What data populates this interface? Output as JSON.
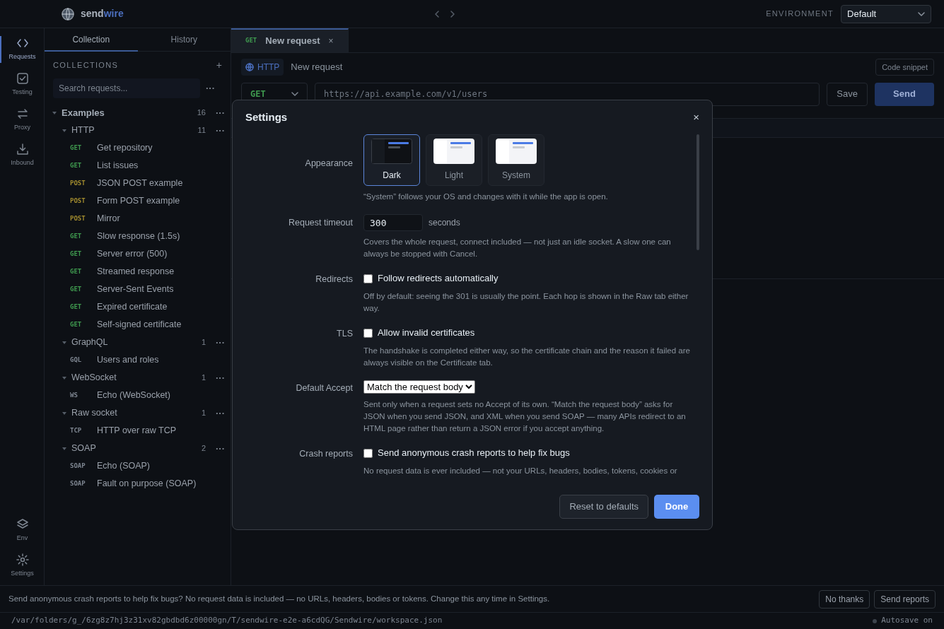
{
  "brand": {
    "first": "send",
    "second": "wire"
  },
  "environment": {
    "label": "ENVIRONMENT",
    "value": "Default"
  },
  "rail": {
    "items": [
      {
        "label": "Requests",
        "selected": true
      },
      {
        "label": "Testing",
        "selected": false
      },
      {
        "label": "Proxy",
        "selected": false
      },
      {
        "label": "Inbound",
        "selected": false
      }
    ],
    "bottom_items": [
      {
        "label": "Env",
        "selected": false
      },
      {
        "label": "Settings",
        "selected": false
      }
    ]
  },
  "panel_tabs": [
    {
      "label": "Collection",
      "selected": true
    },
    {
      "label": "History",
      "selected": false
    }
  ],
  "collections": {
    "heading": "COLLECTIONS",
    "add": "+",
    "search_placeholder": "Search requests...",
    "more": "···"
  },
  "tree": [
    {
      "name": "Examples",
      "count": "16",
      "more": "···",
      "expanded": true,
      "children": [
        {
          "name": "HTTP",
          "count": "11",
          "more": "···",
          "expanded": true,
          "children": [
            {
              "method": "GET",
              "color": "#3f9a4f",
              "name": "Get repository"
            },
            {
              "method": "GET",
              "color": "#3f9a4f",
              "name": "List issues"
            },
            {
              "method": "POST",
              "color": "#a08a2e",
              "name": "JSON POST example"
            },
            {
              "method": "POST",
              "color": "#a08a2e",
              "name": "Form POST example"
            },
            {
              "method": "POST",
              "color": "#a08a2e",
              "name": "Mirror"
            },
            {
              "method": "GET",
              "color": "#3f9a4f",
              "name": "Slow response (1.5s)"
            },
            {
              "method": "GET",
              "color": "#3f9a4f",
              "name": "Server error (500)"
            },
            {
              "method": "GET",
              "color": "#3f9a4f",
              "name": "Streamed response"
            },
            {
              "method": "GET",
              "color": "#3f9a4f",
              "name": "Server-Sent Events"
            },
            {
              "method": "GET",
              "color": "#3f9a4f",
              "name": "Expired certificate"
            },
            {
              "method": "GET",
              "color": "#3f9a4f",
              "name": "Self-signed certificate"
            }
          ]
        },
        {
          "name": "GraphQL",
          "count": "1",
          "more": "···",
          "expanded": true,
          "children": [
            {
              "method": "GQL",
              "color": "#7d8590",
              "name": "Users and roles"
            }
          ]
        },
        {
          "name": "WebSocket",
          "count": "1",
          "more": "···",
          "expanded": true,
          "children": [
            {
              "method": "WS",
              "color": "#7d8590",
              "name": "Echo (WebSocket)"
            }
          ]
        },
        {
          "name": "Raw socket",
          "count": "1",
          "more": "···",
          "expanded": true,
          "children": [
            {
              "method": "TCP",
              "color": "#7d8590",
              "name": "HTTP over raw TCP"
            }
          ]
        },
        {
          "name": "SOAP",
          "count": "2",
          "more": "···",
          "expanded": true,
          "children": [
            {
              "method": "SOAP",
              "color": "#7d8590",
              "name": "Echo (SOAP)"
            },
            {
              "method": "SOAP",
              "color": "#7d8590",
              "name": "Fault on purpose (SOAP)"
            }
          ]
        }
      ]
    }
  ],
  "request_tabs": [
    {
      "method": "GET",
      "title": "New request",
      "close": "×",
      "selected": true
    }
  ],
  "request": {
    "protocol": "HTTP",
    "name": "New request",
    "code_snippet": "Code snippet",
    "method": "GET",
    "url_placeholder": "https://api.example.com/v1/users",
    "save": "Save",
    "send": "Send"
  },
  "settings": {
    "title": "Settings",
    "close": "×",
    "rows": [
      {
        "kind": "theme",
        "label": "Appearance",
        "options": [
          {
            "label": "Dark",
            "kind": "dark",
            "selected": true
          },
          {
            "label": "Light",
            "kind": "light",
            "selected": false
          },
          {
            "label": "System",
            "kind": "system",
            "selected": false
          }
        ],
        "description": "“System” follows your OS and changes with it while the app is open."
      },
      {
        "kind": "number",
        "label": "Request timeout",
        "value": "300",
        "unit": "seconds",
        "description": "Covers the whole request, connect included — not just an idle socket. A slow one can always be stopped with Cancel."
      },
      {
        "kind": "checkbox",
        "label": "Redirects",
        "text": "Follow redirects automatically",
        "checked": false,
        "description": "Off by default: seeing the 301 is usually the point. Each hop is shown in the Raw tab either way."
      },
      {
        "kind": "checkbox",
        "label": "TLS",
        "text": "Allow invalid certificates",
        "checked": false,
        "description": "The handshake is completed either way, so the certificate chain and the reason it failed are always visible on the Certificate tab."
      },
      {
        "kind": "select",
        "label": "Default Accept",
        "value": "Match the request body",
        "description": "Sent only when a request sets no Accept of its own. “Match the request body” asks for JSON when you send JSON, and XML when you send SOAP — many APIs redirect to an HTML page rather than return a JSON error if you accept anything."
      },
      {
        "kind": "checkbox",
        "label": "Crash reports",
        "text": "Send anonymous crash reports to help fix bugs",
        "checked": false,
        "description": "No request data is ever included — not your URLs, headers, bodies, tokens, cookies or"
      }
    ],
    "reset": "Reset to defaults",
    "done": "Done"
  },
  "banner": {
    "text": "Send anonymous crash reports to help fix bugs? No request data is included — no URLs, headers, bodies or tokens. Change this any time in Settings.",
    "decline": "No thanks",
    "accept": "Send reports"
  },
  "status_bar": {
    "path": "/var/folders/g_/6zg8z7hj3z31xv82gbdbd6z00000gn/T/sendwire-e2e-a6cdQG/Sendwire/workspace.json",
    "autosave": "Autosave on"
  }
}
